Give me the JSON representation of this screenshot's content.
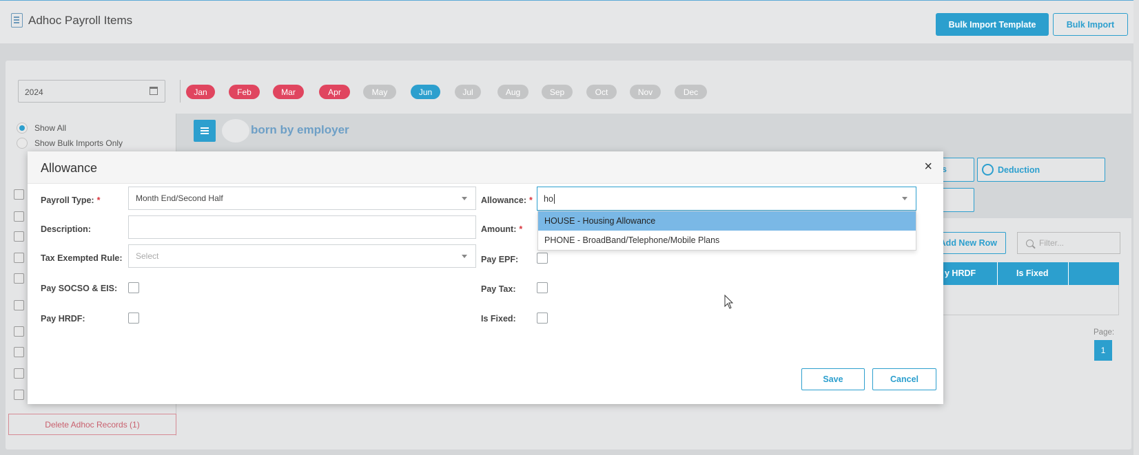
{
  "page": {
    "title": "Adhoc Payroll Items",
    "bulk_import_template": "Bulk Import Template",
    "bulk_import": "Bulk Import"
  },
  "filters": {
    "year": "2024",
    "months": [
      {
        "label": "Jan",
        "state": "red"
      },
      {
        "label": "Feb",
        "state": "red"
      },
      {
        "label": "Mar",
        "state": "red"
      },
      {
        "label": "Apr",
        "state": "red"
      },
      {
        "label": "May",
        "state": "grey"
      },
      {
        "label": "Jun",
        "state": "blue"
      },
      {
        "label": "Jul",
        "state": "grey"
      },
      {
        "label": "Aug",
        "state": "grey"
      },
      {
        "label": "Sep",
        "state": "grey"
      },
      {
        "label": "Oct",
        "state": "grey"
      },
      {
        "label": "Nov",
        "state": "grey"
      },
      {
        "label": "Dec",
        "state": "grey"
      }
    ],
    "show_all": "Show All",
    "show_bulk": "Show Bulk Imports Only"
  },
  "left": {
    "delete_button": "Delete Adhoc Records (1)"
  },
  "right": {
    "toggle_label": "born by employer",
    "deduction_button": "Deduction",
    "partial_button": "s",
    "add_new_row": "Add New Row",
    "filter_placeholder": "Filter...",
    "columns_visible": [
      "y HRDF",
      "Is Fixed"
    ],
    "page_label": "Page:",
    "page_number": "1"
  },
  "modal": {
    "title": "Allowance",
    "close_glyph": "×",
    "payroll_type_label": "Payroll Type:",
    "payroll_type_value": "Month End/Second Half",
    "description_label": "Description:",
    "description_value": "",
    "tax_rule_label": "Tax Exempted Rule:",
    "tax_rule_placeholder": "Select",
    "pay_socso_label": "Pay SOCSO & EIS:",
    "pay_hrdf_label": "Pay HRDF:",
    "allowance_label": "Allowance:",
    "allowance_query": "ho",
    "amount_label": "Amount:",
    "pay_epf_label": "Pay EPF:",
    "pay_tax_label": "Pay Tax:",
    "is_fixed_label": "Is Fixed:",
    "required_mark": "*",
    "options": [
      "HOUSE - Housing Allowance",
      "PHONE - BroadBand/Telephone/Mobile Plans"
    ],
    "save": "Save",
    "cancel": "Cancel"
  },
  "colors": {
    "accent": "#2c9fce",
    "month_red": "#e0455f",
    "month_grey": "#c4c5c6",
    "highlight": "#7ab8e6"
  }
}
